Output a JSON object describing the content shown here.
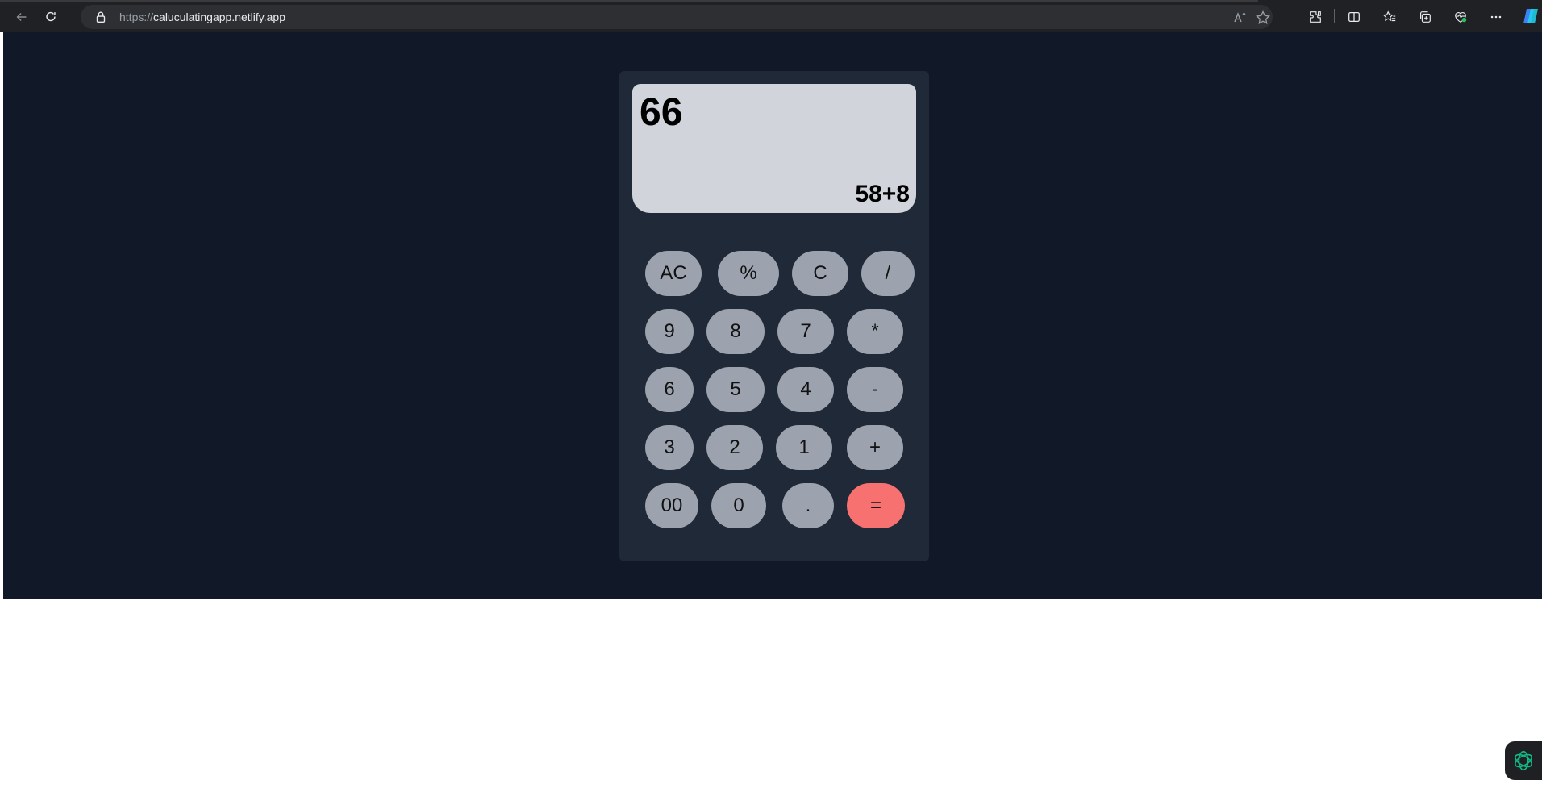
{
  "browser": {
    "url_protocol": "https://",
    "url_host": "caluculatingapp.netlify.app",
    "icons": [
      "back-icon",
      "refresh-icon",
      "lock-icon",
      "read-aloud-icon",
      "favorite-star-icon",
      "extensions-icon",
      "split-screen-icon",
      "favorites-icon",
      "collections-icon",
      "browser-essentials-icon",
      "more-icon",
      "copilot-icon"
    ]
  },
  "calculator": {
    "result": "66",
    "expression": "58+8",
    "keys": {
      "ac": "AC",
      "percent": "%",
      "c": "C",
      "divide": "/",
      "nine": "9",
      "eight": "8",
      "seven": "7",
      "multiply": "*",
      "six": "6",
      "five": "5",
      "four": "4",
      "minus": "-",
      "three": "3",
      "two": "2",
      "one": "1",
      "plus": "+",
      "double_zero": "00",
      "zero": "0",
      "dot": ".",
      "equals": "="
    },
    "colors": {
      "page_bg": "#111827",
      "panel_bg": "#1f2937",
      "screen_bg": "#d1d5db",
      "key_bg": "#9ca3af",
      "equals_bg": "#f87171"
    }
  }
}
